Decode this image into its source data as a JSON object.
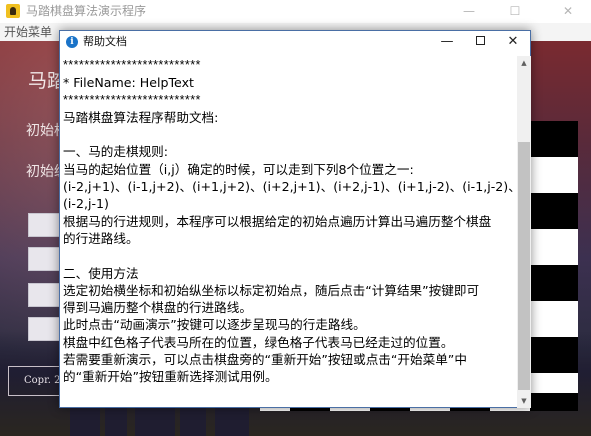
{
  "main_window": {
    "title": "马踏棋盘算法演示程序",
    "menu": [
      "开始菜单"
    ],
    "heading_partial": "马踏",
    "label_x_partial": "初始横",
    "label_y_partial": "初始纵",
    "copyright_partial": "Copr. 20"
  },
  "help_dialog": {
    "title": "帮助文档",
    "icon": "info-icon",
    "lines": [
      "**************************",
      "* FileName: HelpText",
      "**************************",
      "马踏棋盘算法程序帮助文档:",
      "",
      "一、马的走棋规则:",
      "当马的起始位置（i,j）确定的时候，可以走到下列8个位置之一:",
      "(i-2,j+1)、(i-1,j+2)、(i+1,j+2)、(i+2,j+1)、(i+2,j-1)、(i+1,j-2)、(i-1,j-2)、",
      "(i-2,j-1)",
      "根据马的行进规则，本程序可以根据给定的初始点遍历计算出马遍历整个棋盘",
      "的行进路线。",
      "",
      "二、使用方法",
      "选定初始横坐标和初始纵坐标以标定初始点，随后点击“计算结果”按键即可",
      "得到马遍历整个棋盘的行进路线。",
      "此时点击“动画演示”按键可以逐步呈现马的行走路线。",
      "棋盘中红色格子代表马所在的位置，绿色格子代表马已经走过的位置。",
      "若需要重新演示，可以点击棋盘旁的“重新开始”按钮或点击“开始菜单”中",
      "的“重新开始”按钮重新选择测试用例。"
    ]
  },
  "colors": {
    "dialog_border": "#4a6fa5",
    "info_icon": "#1a73c8",
    "board_black": "#000000",
    "board_white": "#ffffff"
  }
}
